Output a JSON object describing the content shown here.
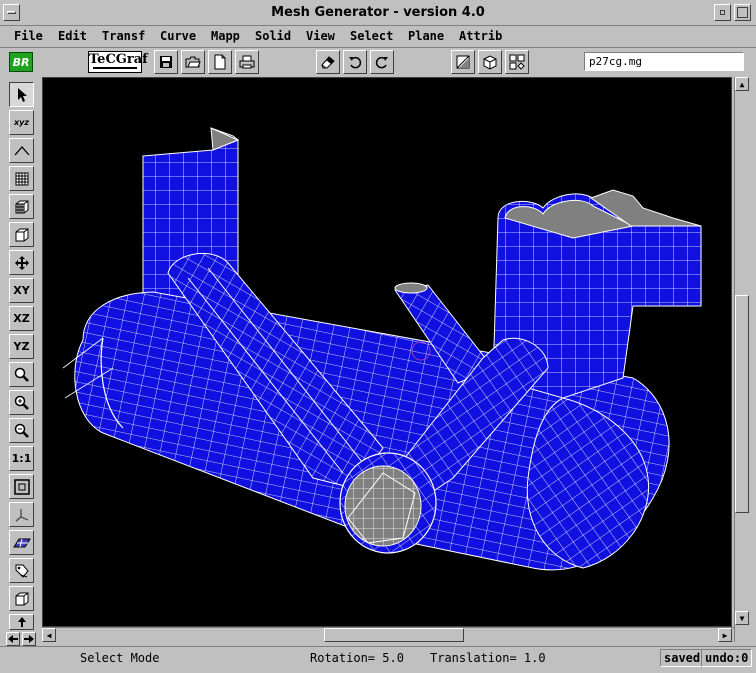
{
  "window": {
    "title": "Mesh Generator - version 4.0"
  },
  "menu": [
    "File",
    "Edit",
    "Transf",
    "Curve",
    "Mapp",
    "Solid",
    "View",
    "Select",
    "Plane",
    "Attrib"
  ],
  "toolbar": {
    "logo_label": "BR",
    "brand": "TeCGraf",
    "filename": "p27cg.mg",
    "buttons": [
      "save-icon",
      "open-icon",
      "new-file-icon",
      "print-icon",
      "eraser-icon",
      "undo-icon",
      "redo-icon",
      "plane-icon",
      "cube-icon",
      "multi-view-icon"
    ]
  },
  "left_tools": {
    "xyz_label": "xyz",
    "xy_label": "XY",
    "xz_label": "XZ",
    "yz_label": "YZ",
    "one_to_one_label": "1:1"
  },
  "status": {
    "mode": "Select Mode",
    "rotation": "Rotation= 5.0",
    "translation": "Translation= 1.0",
    "saved": "saved",
    "undo": "undo:0"
  },
  "colors": {
    "mesh_fill": "#1010e0",
    "mesh_line": "#ffffff",
    "mesh_inner": "#808080",
    "background": "#000000"
  }
}
